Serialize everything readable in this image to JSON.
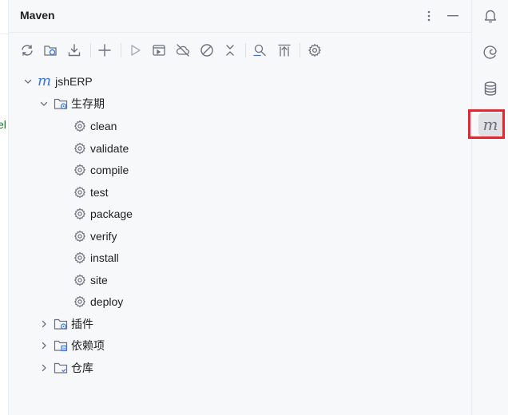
{
  "panel": {
    "title": "Maven"
  },
  "left_edge": {
    "partial_text": "el"
  },
  "toolbar": {
    "buttons": [
      {
        "icon": "reload-icon"
      },
      {
        "icon": "generate-sources-icon"
      },
      {
        "icon": "download-icon"
      },
      {
        "icon": "add-icon"
      },
      {
        "icon": "run-icon"
      },
      {
        "icon": "run-config-icon"
      },
      {
        "icon": "offline-mode-icon"
      },
      {
        "icon": "skip-tests-icon"
      },
      {
        "icon": "collapse-all-icon"
      },
      {
        "icon": "analyze-dependencies-icon"
      },
      {
        "icon": "show-dependencies-icon"
      },
      {
        "icon": "settings-icon"
      }
    ]
  },
  "tree": {
    "root": {
      "label": "jshERP",
      "logo": "m"
    },
    "lifecycle": {
      "label": "生存期",
      "items": [
        "clean",
        "validate",
        "compile",
        "test",
        "package",
        "verify",
        "install",
        "site",
        "deploy"
      ]
    },
    "plugins": {
      "label": "插件"
    },
    "dependencies": {
      "label": "依赖项"
    },
    "repositories": {
      "label": "仓库"
    }
  },
  "right_bar": {
    "items": [
      {
        "icon": "notifications-bell-icon"
      },
      {
        "icon": "ai-assistant-spiral-icon"
      },
      {
        "icon": "database-icon"
      },
      {
        "icon": "maven-icon",
        "label": "m",
        "active": true
      }
    ],
    "highlight_color": "#e6262a"
  },
  "colors": {
    "accent": "#3574f0",
    "icon_gray": "#6c707e",
    "text": "#1f1f1f"
  }
}
